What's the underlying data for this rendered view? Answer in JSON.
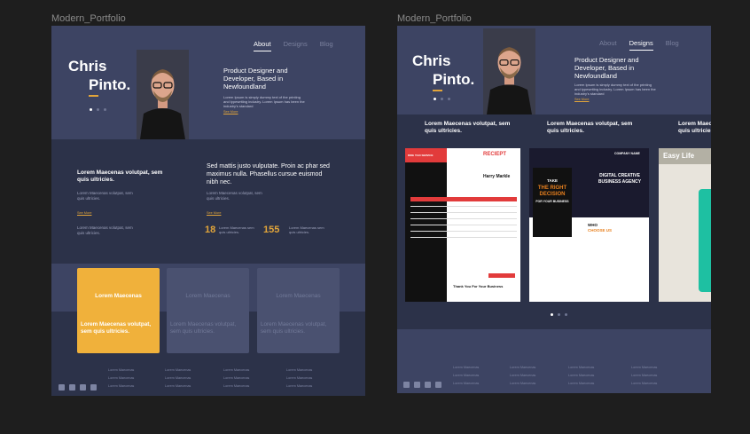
{
  "frames": [
    {
      "label": "Modern_Portfolio",
      "nav": [
        "About",
        "Designs",
        "Blog"
      ],
      "active_nav": 0,
      "hero": {
        "first_name": "Chris",
        "last_name": "Pinto.",
        "title": "Product Designer and Developer, Based in Newfoundland",
        "description": "Lorem Ipsum is simply dummy text of the printing and typesetting industry. Lorem Ipsum has been the industry's standard",
        "see_more": "See More"
      },
      "about": {
        "left_title": "Lorem Maecenas volutpat, sem quis ultricies.",
        "left_sub": "Lorem Maecenas volutpat, sem quis ultricies.",
        "left_see_more": "See More",
        "left_foot": "Lorem Maecenas volutpat, sem quis ultricies.",
        "right_title": "Sed mattis justo vulputate. Proin ac phar sed maximus nulla. Phasellus cursue euismod nibh nec.",
        "right_sub": "Lorem Maecenas volutpat, sem quis ultricies.",
        "right_see_more": "See More",
        "stats": [
          {
            "value": "18",
            "label": "Lorem Maecenas sem quis ultricies."
          },
          {
            "value": "155",
            "label": "Lorem Maecenas sem quis ultricies."
          }
        ]
      },
      "cards": [
        {
          "title": "Lorem Maecenas",
          "body": "Lorem Maecenas volutpat, sem quis ultricies.",
          "active": true
        },
        {
          "title": "Lorem Maecenas",
          "body": "Lorem Maecenas volutpat, sem quis ultricies.",
          "active": false
        },
        {
          "title": "Lorem Maecenas",
          "body": "Lorem Maecenas volutpat, sem quis ultricies.",
          "active": false
        }
      ],
      "footer_cols": [
        [
          "Lorem Maecenas",
          "Lorem Maecenas",
          "Lorem Maecenas"
        ],
        [
          "Lorem Maecenas",
          "Lorem Maecenas",
          "Lorem Maecenas"
        ],
        [
          "Lorem Maecenas",
          "Lorem Maecenas",
          "Lorem Maecenas"
        ],
        [
          "Lorem Maecenas",
          "Lorem Maecenas",
          "Lorem Maecenas"
        ]
      ],
      "social_icons": [
        "facebook-icon",
        "instagram-icon",
        "twitter-icon",
        "youtube-icon"
      ]
    },
    {
      "label": "Modern_Portfolio",
      "nav": [
        "About",
        "Designs",
        "Blog"
      ],
      "active_nav": 1,
      "hero": {
        "first_name": "Chris",
        "last_name": "Pinto.",
        "title": "Product Designer and Developer, Based in Newfoundland",
        "description": "Lorem Ipsum is simply dummy text of the printing and typesetting industry. Lorem Ipsum has been the industry's standard",
        "see_more": "See More"
      },
      "services": [
        "Lorem Maecenas volutpat, sem quis ultricies.",
        "Lorem Maecenas volutpat, sem quis ultricies.",
        "Lorem Maecenas volutpat, sem quis ultricies."
      ],
      "thumbnails": {
        "receipt": {
          "brand": "RIDE TAXI SERVICE",
          "title": "RECIEPT",
          "customer": "Harry Markle",
          "thanks": "Thank You For Your Business"
        },
        "poster": {
          "brand": "COMPANY NAME",
          "left_top": "TAKE",
          "left_main": "THE RIGHT DECISION",
          "left_sub": "FOR YOUR BUSINESS",
          "right_main": "DIGITAL CREATIVE BUSINESS AGENCY",
          "who": "WHO",
          "choose": "CHOOSE US"
        },
        "app": {
          "title": "Easy Life"
        }
      },
      "footer_cols": [
        [
          "Lorem Maecenas",
          "Lorem Maecenas",
          "Lorem Maecenas"
        ],
        [
          "Lorem Maecenas",
          "Lorem Maecenas",
          "Lorem Maecenas"
        ],
        [
          "Lorem Maecenas",
          "Lorem Maecenas",
          "Lorem Maecenas"
        ],
        [
          "Lorem Maecenas",
          "Lorem Maecenas",
          "Lorem Maecenas"
        ]
      ],
      "social_icons": [
        "facebook-icon",
        "instagram-icon",
        "twitter-icon",
        "youtube-icon"
      ]
    }
  ],
  "colors": {
    "canvas": "#1e1e1e",
    "frame_bg": "#3d4463",
    "section_dark": "#2c3249",
    "accent": "#e2a53a",
    "card_active": "#f0b13b",
    "card_inactive": "#4a5170"
  }
}
